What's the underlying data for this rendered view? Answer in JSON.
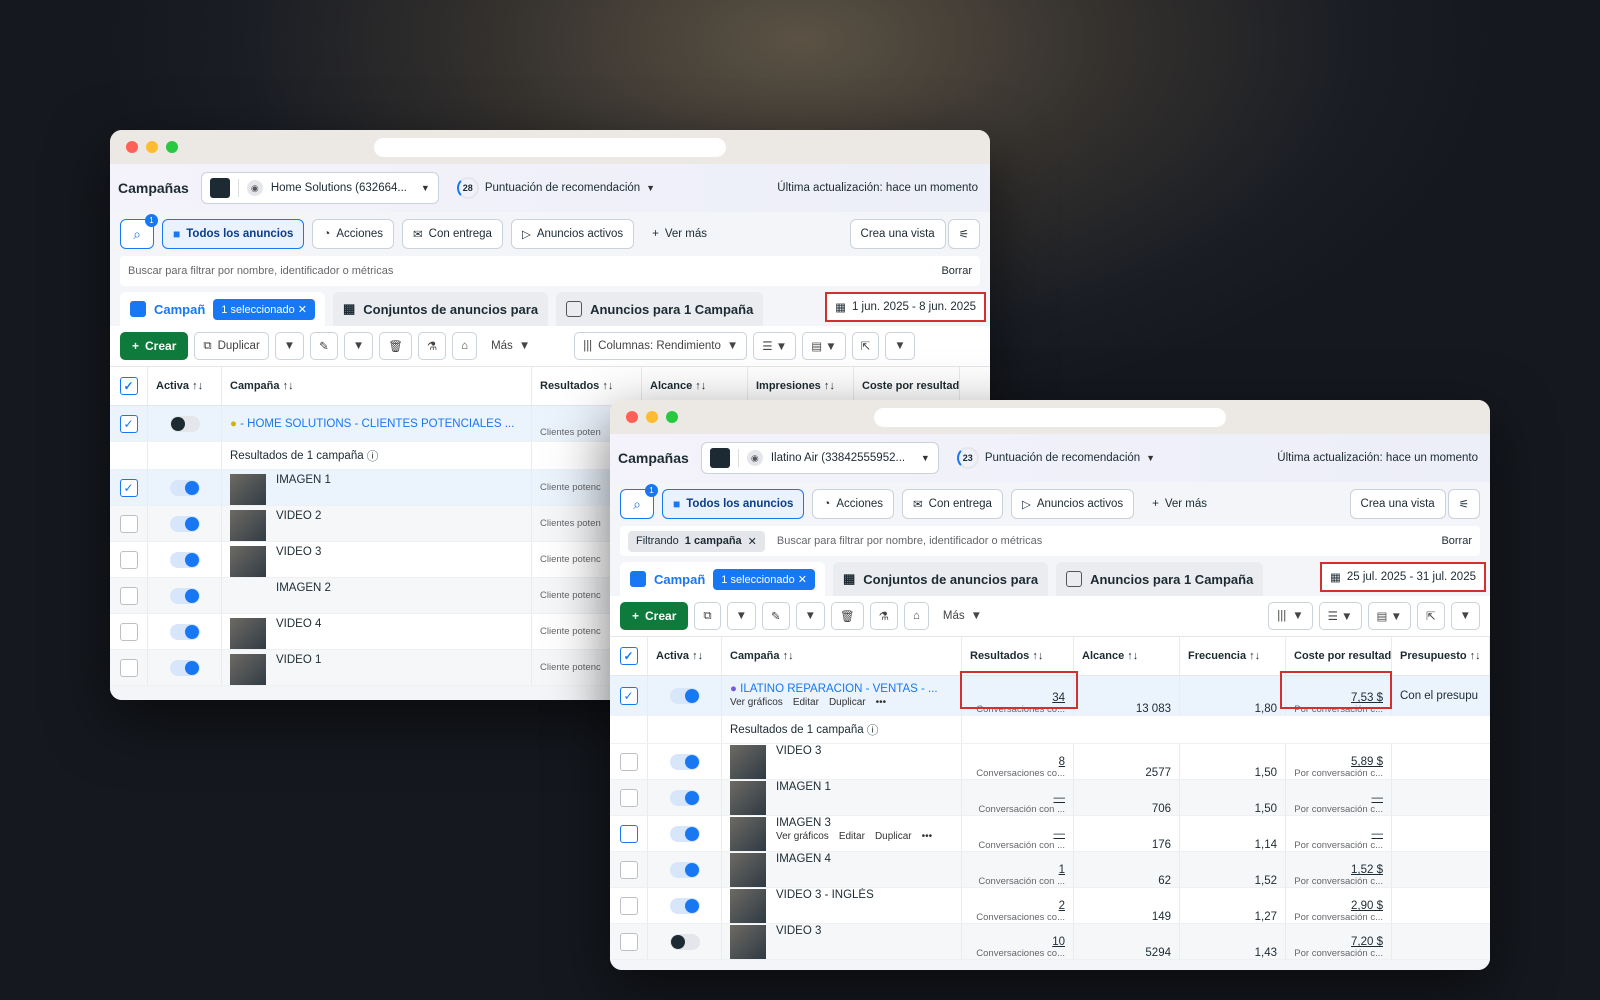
{
  "w1": {
    "title": "Campañas",
    "account": "Home Solutions (632664...",
    "score": "28",
    "score_label": "Puntuación de recomendación",
    "updated": "Última actualización: hace un momento",
    "search_badge": "1",
    "chips": [
      "Todos los anuncios",
      "Acciones",
      "Con entrega",
      "Anuncios activos",
      "Ver más"
    ],
    "create_view": "Crea una vista",
    "filter_placeholder": "Buscar para filtrar por nombre, identificador o métricas",
    "clear": "Borrar",
    "tab1": "Campañ",
    "selected": "1 seleccionado",
    "tab2": "Conjuntos de anuncios para",
    "tab3": "Anuncios para 1 Campaña",
    "date": "1 jun. 2025 - 8 jun. 2025",
    "create": "Crear",
    "duplicate": "Duplicar",
    "more": "Más",
    "columns": "Columnas: Rendimiento",
    "headers": [
      "Activa ↑↓",
      "Campaña ↑↓",
      "Resultados ↑↓",
      "Alcance ↑↓",
      "Impresiones ↑↓",
      "Coste por resultado ↑↓"
    ],
    "campaign_name": "- HOME SOLUTIONS - CLIENTES POTENCIALES ...",
    "campaign_result_sub": "Clientes poten",
    "summary": "Resultados de 1 campaña",
    "rows": [
      {
        "name": "IMAGEN 1",
        "sub": "Cliente potenc"
      },
      {
        "name": "VIDEO 2",
        "sub": "Clientes poten"
      },
      {
        "name": "VIDEO 3",
        "sub": "Cliente potenc"
      },
      {
        "name": "IMAGEN 2",
        "sub": "Cliente potenc"
      },
      {
        "name": "VIDEO 4",
        "sub": "Cliente potenc"
      },
      {
        "name": "VIDEO 1",
        "sub": "Cliente potenc"
      }
    ]
  },
  "w2": {
    "title": "Campañas",
    "account": "Ilatino Air (33842555952...",
    "score": "23",
    "score_label": "Puntuación de recomendación",
    "updated": "Última actualización: hace un momento",
    "search_badge": "1",
    "chips": [
      "Todos los anuncios",
      "Acciones",
      "Con entrega",
      "Anuncios activos",
      "Ver más"
    ],
    "create_view": "Crea una vista",
    "filter_prefix": "Filtrando",
    "filter_strong": "1 campaña",
    "filter_placeholder": "Buscar para filtrar por nombre, identificador o métricas",
    "clear": "Borrar",
    "tab1": "Campañ",
    "selected": "1 seleccionado",
    "tab2": "Conjuntos de anuncios para",
    "tab3": "Anuncios para 1 Campaña",
    "date": "25 jul. 2025 - 31 jul. 2025",
    "create": "Crear",
    "more": "Más",
    "headers": [
      "Activa ↑↓",
      "Campaña ↑↓",
      "Resultados ↑↓",
      "Alcance ↑↓",
      "Frecuencia ↑↓",
      "Coste por resultado ↑↓",
      "Presupuesto ↑↓"
    ],
    "campaign": {
      "name": "ILATINO REPARACION - VENTAS - ...",
      "results": "34",
      "results_sub": "Conversaciones co...",
      "reach": "13 083",
      "freq": "1,80",
      "cost": "7,53 $",
      "cost_sub": "Por conversación c...",
      "budget": "Con el presupu",
      "actions": [
        "Ver gráficos",
        "Editar",
        "Duplicar"
      ]
    },
    "summary": "Resultados de 1 campaña",
    "row_actions": [
      "Ver gráficos",
      "Editar",
      "Duplicar"
    ],
    "rows": [
      {
        "name": "VIDEO 3",
        "results": "8",
        "results_sub": "Conversaciones co...",
        "reach": "2577",
        "freq": "1,50",
        "cost": "5,89 $",
        "cost_sub": "Por conversación c...",
        "on": true
      },
      {
        "name": "IMAGEN 1",
        "results": "—",
        "results_sub": "Conversación con ...",
        "reach": "706",
        "freq": "1,50",
        "cost": "—",
        "cost_sub": "Por conversación c...",
        "on": true
      },
      {
        "name": "IMAGEN 3",
        "results": "—",
        "results_sub": "Conversación con ...",
        "reach": "176",
        "freq": "1,14",
        "cost": "—",
        "cost_sub": "Por conversación c...",
        "on": true
      },
      {
        "name": "IMAGEN 4",
        "results": "1",
        "results_sub": "Conversación con ...",
        "reach": "62",
        "freq": "1,52",
        "cost": "1,52 $",
        "cost_sub": "Por conversación c...",
        "on": true
      },
      {
        "name": "VIDEO 3 - INGLÉS",
        "results": "2",
        "results_sub": "Conversaciones co...",
        "reach": "149",
        "freq": "1,27",
        "cost": "2,90 $",
        "cost_sub": "Por conversación c...",
        "on": true
      },
      {
        "name": "VIDEO 3",
        "results": "10",
        "results_sub": "Conversaciones co...",
        "reach": "5294",
        "freq": "1,43",
        "cost": "7,20 $",
        "cost_sub": "Por conversación c...",
        "on": false
      }
    ]
  }
}
